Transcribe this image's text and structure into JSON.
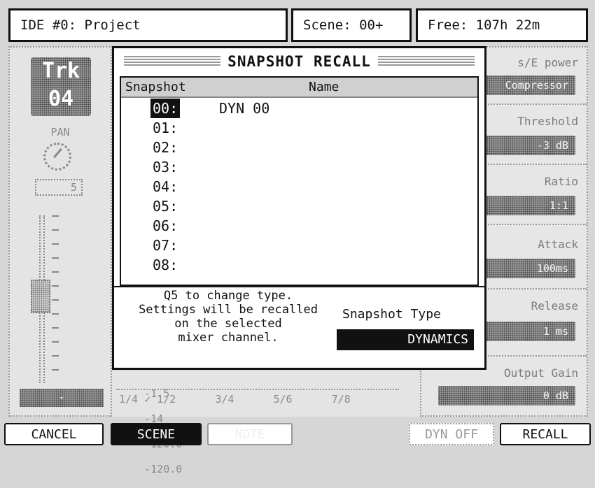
{
  "header": {
    "project": "IDE #0: Project",
    "scene": "Scene: 00+",
    "free": "Free: 107h 22m"
  },
  "left_strip": {
    "track_line1": "Trk",
    "track_line2": "04",
    "pan_label": "PAN",
    "pan_value": "5",
    "level": "-"
  },
  "right_panel": {
    "title": "s/E power",
    "type_value": "Compressor",
    "threshold_label": "Threshold",
    "threshold_value": "-3 dB",
    "ratio_label": "Ratio",
    "ratio_value": "1:1",
    "attack_label": "Attack",
    "attack_value": "100ms",
    "release_label": "Release",
    "release_value": "1 ms",
    "output_gain_label": "Output Gain",
    "output_gain_value": "0 dB"
  },
  "bottom_meters": {
    "row1": [
      "-1.5",
      "-14",
      "-120.0",
      "-120.0"
    ],
    "row2": [
      "1/4 ✓ 1/2",
      "3/4",
      "5/6",
      "7/8"
    ]
  },
  "modal": {
    "title": "SNAPSHOT RECALL",
    "col_snapshot": "Snapshot",
    "col_name": "Name",
    "rows": [
      {
        "num": "00:",
        "name": "DYN 00"
      },
      {
        "num": "01:",
        "name": ""
      },
      {
        "num": "02:",
        "name": ""
      },
      {
        "num": "03:",
        "name": ""
      },
      {
        "num": "04:",
        "name": ""
      },
      {
        "num": "05:",
        "name": ""
      },
      {
        "num": "06:",
        "name": ""
      },
      {
        "num": "07:",
        "name": ""
      },
      {
        "num": "08:",
        "name": ""
      }
    ],
    "help_line1": "Q5 to change type.",
    "help_line2": "Settings will be recalled",
    "help_line3": "on the selected",
    "help_line4": "mixer channel.",
    "type_label": "Snapshot Type",
    "type_value": "DYNAMICS"
  },
  "buttons": {
    "cancel": "CANCEL",
    "scene": "SCENE",
    "note": "NOTE",
    "dyn_off": "DYN OFF",
    "recall": "RECALL"
  }
}
